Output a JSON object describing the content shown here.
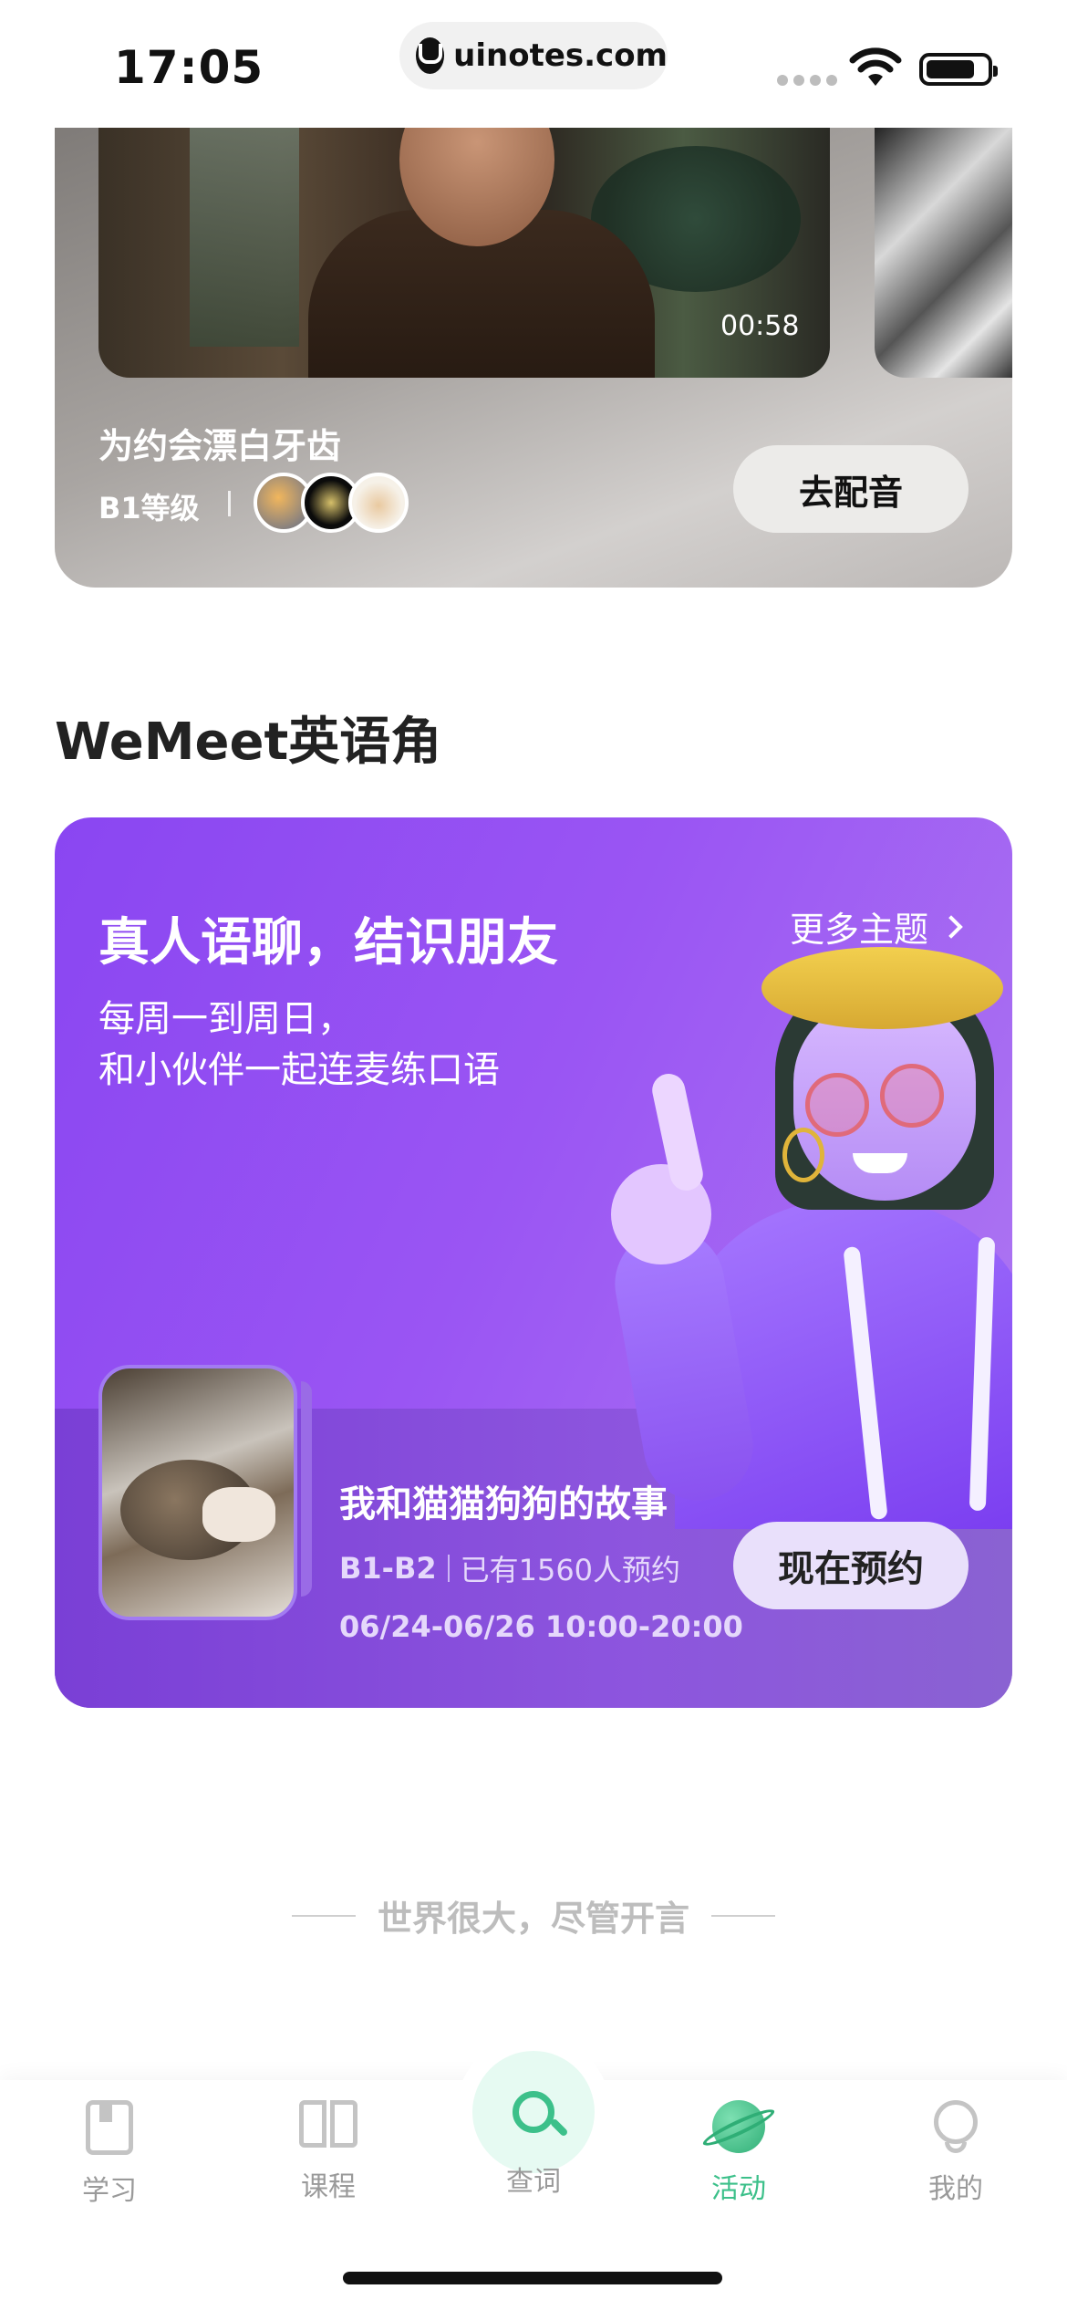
{
  "status_bar": {
    "time": "17:05",
    "url": "uinotes.com"
  },
  "video_card": {
    "duration": "00:58",
    "title": "为约会漂白牙齿",
    "level": "B1等级",
    "action_label": "去配音"
  },
  "section": {
    "title": "WeMeet英语角"
  },
  "wemeet_card": {
    "headline": "真人语聊，结识朋友",
    "subtitle_line1": "每周一到周日，",
    "subtitle_line2": "和小伙伴一起连麦练口语",
    "more_label": "更多主题",
    "event": {
      "title": "我和猫猫狗狗的故事",
      "level": "B1-B2",
      "booked": "已有1560人预约",
      "date": "06/24-06/26 10:00-20:00",
      "action_label": "现在预约"
    }
  },
  "slogan": "世界很大，尽管开言",
  "tab_bar": {
    "items": [
      {
        "label": "学习",
        "icon": "study-book-icon"
      },
      {
        "label": "课程",
        "icon": "course-open-book-icon"
      },
      {
        "label": "查词",
        "icon": "search-icon"
      },
      {
        "label": "活动",
        "icon": "planet-icon",
        "active": true
      },
      {
        "label": "我的",
        "icon": "profile-icon"
      }
    ],
    "active_color": "#3cc08a"
  },
  "colors": {
    "accent_green": "#3cc08a",
    "card_purple": "#8a46f2"
  }
}
